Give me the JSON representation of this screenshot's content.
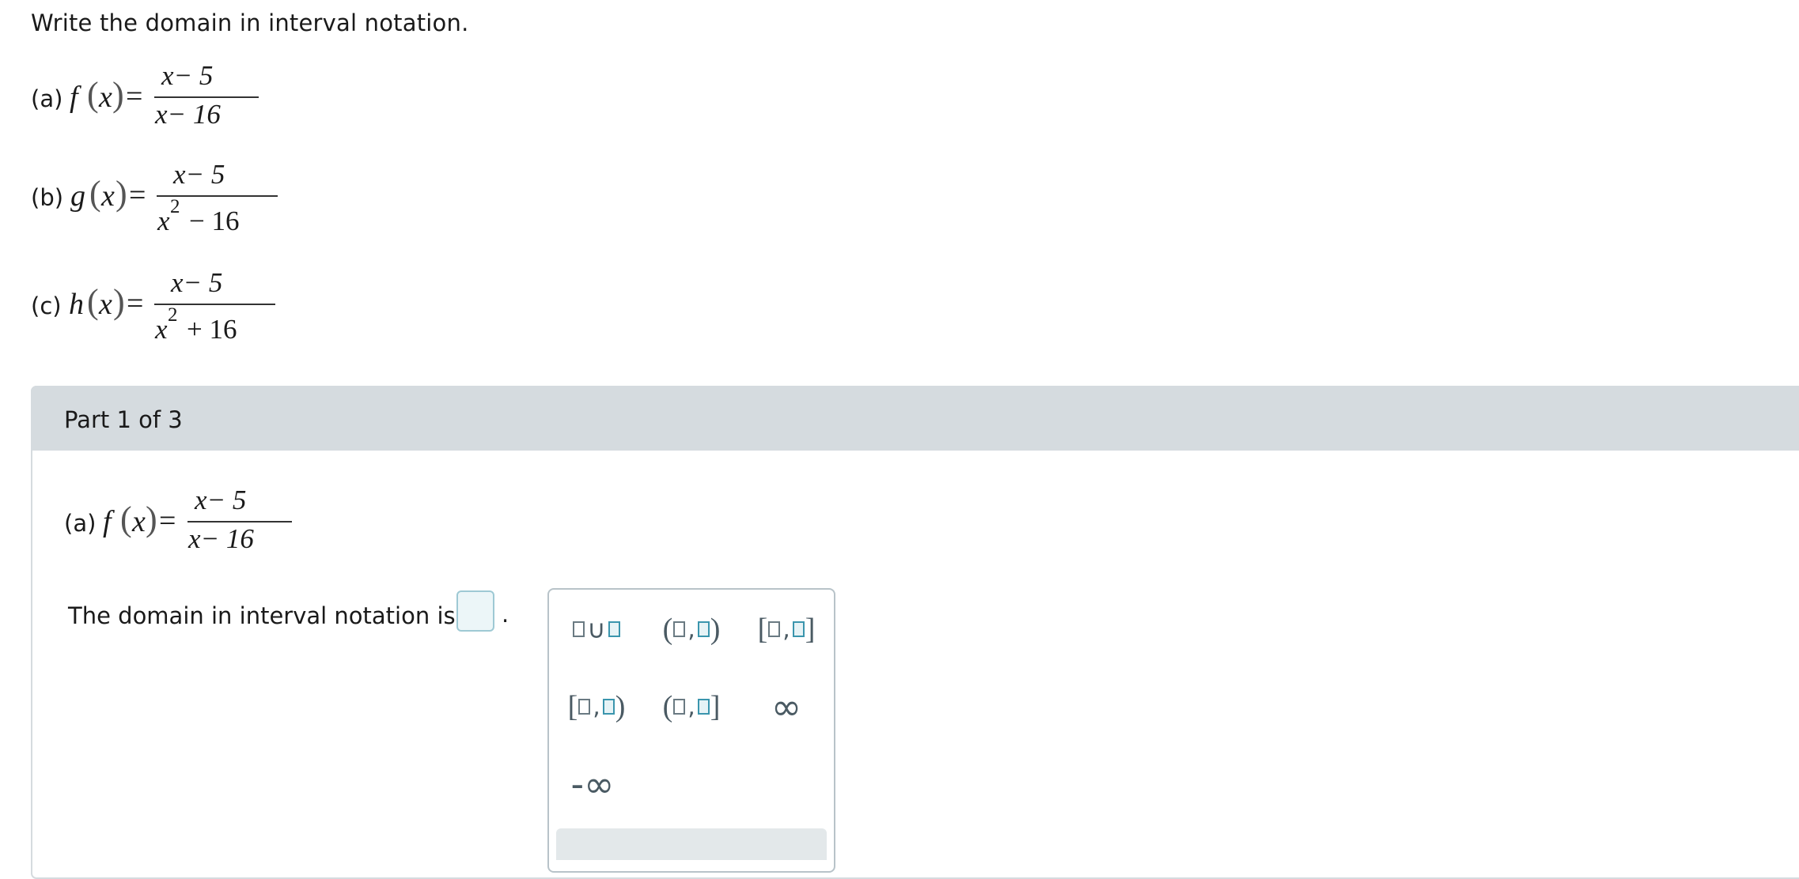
{
  "prompt": "Write the domain in interval notation.",
  "problems": {
    "a": {
      "label": "(a)",
      "fn": "f",
      "var": "x",
      "num": "x− 5",
      "den": "x− 16"
    },
    "b": {
      "label": "(b)",
      "fn": "g",
      "var": "x",
      "num": "x− 5",
      "den_base": "x",
      "den_exp": "2",
      "den_rest": "− 16"
    },
    "c": {
      "label": "(c)",
      "fn": "h",
      "var": "x",
      "num": "x− 5",
      "den_base": "x",
      "den_exp": "2",
      "den_rest": "+ 16"
    }
  },
  "part": {
    "title": "Part 1 of 3",
    "problem": {
      "label": "(a)",
      "fn": "f",
      "var": "x",
      "num": "x− 5",
      "den": "x− 16"
    },
    "answer_prompt": "The domain in interval notation is",
    "period": "."
  },
  "palette": {
    "union_symbol": "∪",
    "comma": ",",
    "open_paren": "(",
    "close_paren": ")",
    "open_bracket": "[",
    "close_bracket": "]",
    "infinity": "∞",
    "neg_infinity": "-∞"
  },
  "colors": {
    "panel_header_bg": "#d5dbdf",
    "answer_box_border": "#9ec9d4",
    "palette_highlight": "#3a95ad",
    "palette_text": "#4a5a63"
  }
}
